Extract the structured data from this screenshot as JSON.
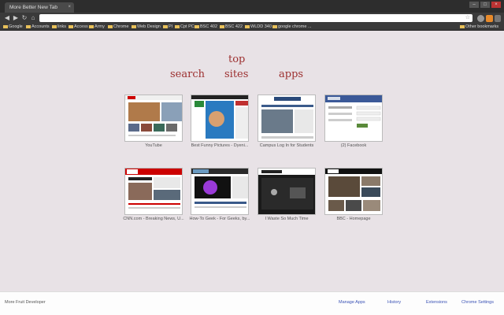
{
  "window": {
    "tab_title": "More Better New Tab",
    "tab_close": "×",
    "minimize": "–",
    "maximize": "□",
    "close": "×"
  },
  "toolbar": {
    "back": "◀",
    "forward": "▶",
    "reload": "↻",
    "home": "⌂",
    "address_value": "",
    "star": "☆"
  },
  "bookmarks": [
    "Google",
    "Accounts",
    "links",
    "Access",
    "Army",
    "Chrome",
    "Web Design",
    "PI",
    "Cpt PC",
    "BSC 402",
    "BSC 422",
    "WLDD 340",
    "google chrome ..."
  ],
  "bookmarks_other": "Other bookmarks",
  "menu": {
    "search": "search",
    "top": "top",
    "sites": "sites",
    "apps": "apps"
  },
  "tiles": [
    {
      "label": "YouTube"
    },
    {
      "label": "Best Funny Pictures - Dyeni..."
    },
    {
      "label": "Campus Log In for Students"
    },
    {
      "label": "(2) Facebook"
    },
    {
      "label": "CNN.com - Breaking News, U..."
    },
    {
      "label": "How-To Geek - For Geeks, by..."
    },
    {
      "label": "I Waste So Much Time"
    },
    {
      "label": "BBC - Homepage"
    }
  ],
  "footer": {
    "developer": "More Fruit Developer",
    "manage_apps": "Manage Apps",
    "history": "History",
    "extensions": "Extensions",
    "chrome_settings": "Chrome Settings"
  },
  "colors": {
    "accent": "#9c2f2f",
    "link": "#3a52b5",
    "page_bg": "#e8e2e6"
  }
}
